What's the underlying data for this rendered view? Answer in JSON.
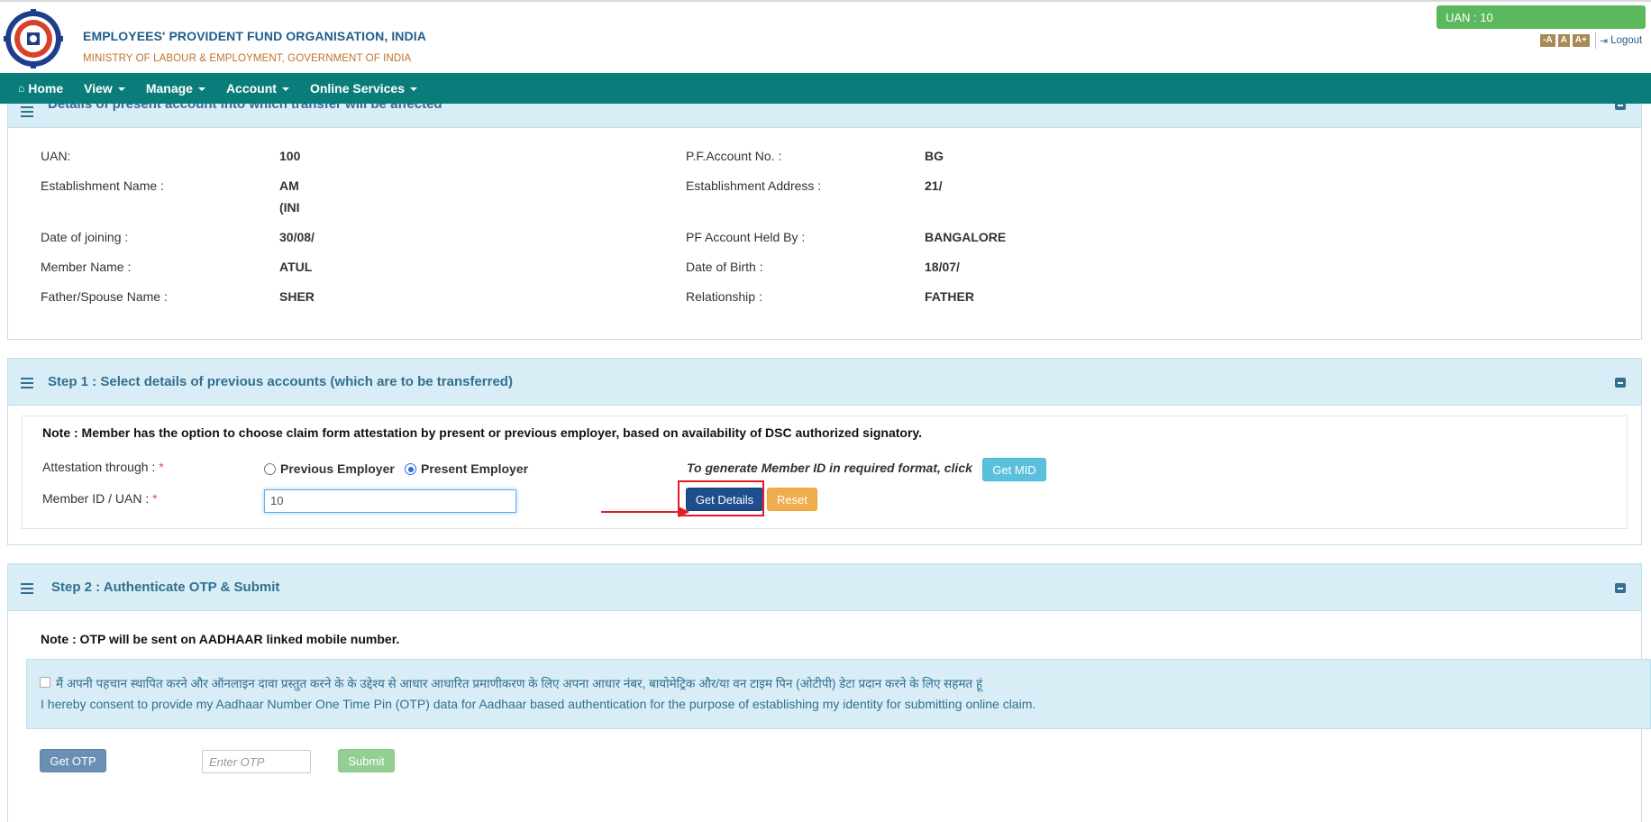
{
  "header": {
    "org_name": "EMPLOYEES' PROVIDENT FUND ORGANISATION, INDIA",
    "ministry": "MINISTRY OF LABOUR & EMPLOYMENT, GOVERNMENT OF INDIA",
    "uan_badge": "UAN : 10",
    "font_small": "-A",
    "font_normal": "A",
    "font_large": "A+",
    "logout": "Logout"
  },
  "nav": {
    "home": "Home",
    "view": "View",
    "manage": "Manage",
    "account": "Account",
    "online_services": "Online Services"
  },
  "present_account": {
    "title": "Details of present account into which transfer will be affected",
    "fields": {
      "uan_label": "UAN:",
      "uan_value": "100",
      "pf_label": "P.F.Account No. :",
      "pf_value": "BG",
      "est_name_label": "Establishment Name :",
      "est_name_value_1": "AM",
      "est_name_value_2": "(INI",
      "est_addr_label": "Establishment Address :",
      "est_addr_value": "21/",
      "doj_label": "Date of joining :",
      "doj_value": "30/08/",
      "held_by_label": "PF Account Held By :",
      "held_by_value": "BANGALORE",
      "member_name_label": "Member Name :",
      "member_name_value": "ATUL",
      "dob_label": "Date of Birth :",
      "dob_value": "18/07/",
      "father_label": "Father/Spouse Name :",
      "father_value": "SHER",
      "relationship_label": "Relationship :",
      "relationship_value": "FATHER"
    }
  },
  "step1": {
    "title": "Step 1 : Select details of previous accounts (which are to be transferred)",
    "note": "Note : Member has the option to choose claim form attestation by present or previous employer, based on availability of DSC authorized signatory.",
    "attestation_label": "Attestation through :",
    "required_mark": "*",
    "option_previous": "Previous Employer",
    "option_present": "Present Employer",
    "selected_option": "Present Employer",
    "mid_hint": "To generate Member ID in required format, click",
    "get_mid_label": "Get MID",
    "member_id_label": "Member ID / UAN :",
    "member_id_value": "10",
    "get_details_label": "Get Details",
    "reset_label": "Reset"
  },
  "step2": {
    "title": "Step 2 : Authenticate OTP & Submit",
    "note": "Note : OTP will be sent on AADHAAR linked mobile number.",
    "consent_hindi": "मैं अपनी पहचान स्थापित करने और ऑनलाइन दावा प्रस्तुत करने के के उद्देश्य से आधार आधारित प्रमाणीकरण के लिए अपना आधार नंबर, बायोमेट्रिक और/या वन टाइम पिन (ओटीपी) डेटा प्रदान करने के लिए सहमत हूं",
    "consent_english": "I hereby consent to provide my Aadhaar Number One Time Pin (OTP) data for Aadhaar based authentication for the purpose of establishing my identity for submitting online claim.",
    "get_otp_label": "Get OTP",
    "otp_placeholder": "Enter OTP",
    "submit_label": "Submit"
  },
  "colors": {
    "nav_bg": "#0a7d7a",
    "panel_head_bg": "#d9edf7",
    "primary_btn": "#1f4e8f",
    "highlight": "#e51c23"
  }
}
